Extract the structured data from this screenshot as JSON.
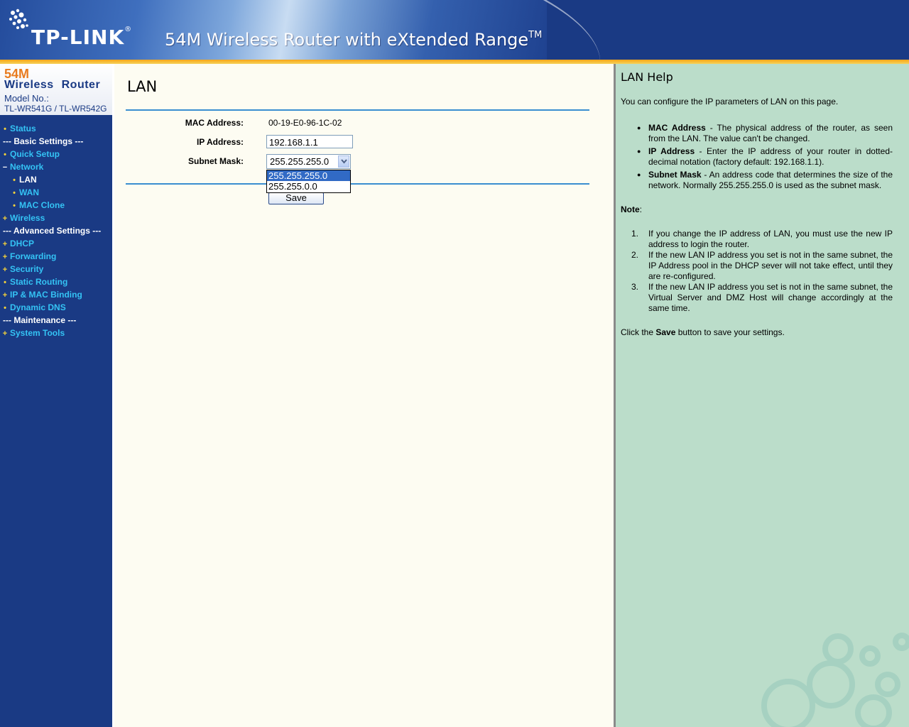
{
  "header": {
    "brand": "TP-LINK",
    "title": "54M Wireless Router with eXtended Range",
    "title_tm": "TM"
  },
  "sidebar": {
    "model": {
      "speed": "54M",
      "product": "Wireless Router",
      "model_label": "Model No.:",
      "model_number": "TL-WR541G / TL-WR542G"
    },
    "menu": [
      {
        "label": "Status",
        "kind": "item",
        "bullet": "•"
      },
      {
        "label": "--- Basic Settings ---",
        "kind": "section"
      },
      {
        "label": "Quick Setup",
        "kind": "item",
        "bullet": "•"
      },
      {
        "label": "Network",
        "kind": "item",
        "bullet": "−"
      },
      {
        "label": "LAN",
        "kind": "sub",
        "bullet": "•"
      },
      {
        "label": "WAN",
        "kind": "sub",
        "bullet": "•"
      },
      {
        "label": "MAC Clone",
        "kind": "sub",
        "bullet": "•"
      },
      {
        "label": "Wireless",
        "kind": "item",
        "bullet": "+"
      },
      {
        "label": "--- Advanced Settings ---",
        "kind": "section"
      },
      {
        "label": "DHCP",
        "kind": "item",
        "bullet": "+"
      },
      {
        "label": "Forwarding",
        "kind": "item",
        "bullet": "+"
      },
      {
        "label": "Security",
        "kind": "item",
        "bullet": "+"
      },
      {
        "label": "Static Routing",
        "kind": "item",
        "bullet": "•"
      },
      {
        "label": "IP & MAC Binding",
        "kind": "item",
        "bullet": "+"
      },
      {
        "label": "Dynamic DNS",
        "kind": "item",
        "bullet": "•"
      },
      {
        "label": "--- Maintenance ---",
        "kind": "section"
      },
      {
        "label": "System Tools",
        "kind": "item",
        "bullet": "+"
      }
    ]
  },
  "main": {
    "title": "LAN",
    "mac_label": "MAC Address:",
    "mac_value": "00-19-E0-96-1C-02",
    "ip_label": "IP Address:",
    "ip_value": "192.168.1.1",
    "mask_label": "Subnet Mask:",
    "mask_value": "255.255.255.0",
    "mask_options": [
      "255.255.255.0",
      "255.255.0.0"
    ],
    "save_label": "Save"
  },
  "help": {
    "title": "LAN Help",
    "intro": "You can configure the IP parameters of LAN on this page.",
    "items": [
      {
        "term": "MAC Address",
        "text": " - The physical address of the router, as seen from the LAN. The value can't be changed."
      },
      {
        "term": "IP Address",
        "text": " - Enter the IP address of your router in dotted-decimal notation (factory default: 192.168.1.1)."
      },
      {
        "term": "Subnet Mask",
        "text": " - An address code that determines the size of the network. Normally 255.255.255.0 is used as the subnet mask."
      }
    ],
    "note_label": "Note",
    "notes": [
      {
        "num": "1.",
        "text": "If you change the IP address of LAN, you must use the new IP address to login the router."
      },
      {
        "num": "2.",
        "text": "If the new LAN IP address you set is not in the same subnet, the IP Address pool in the DHCP sever will not take effect, until they are re-configured."
      },
      {
        "num": "3.",
        "text": "If the new LAN IP address you set is not in the same subnet, the Virtual Server and DMZ Host will change accordingly at the same time."
      }
    ],
    "footer_pre": "Click the ",
    "footer_bold": "Save",
    "footer_post": " button to save your settings."
  },
  "colors": {
    "header_bg": "#1a3a84",
    "menu_link": "#34c3f4",
    "accent_orange": "#f7a516",
    "help_bg": "#bbddca",
    "rule_blue": "#3a8ed0"
  }
}
